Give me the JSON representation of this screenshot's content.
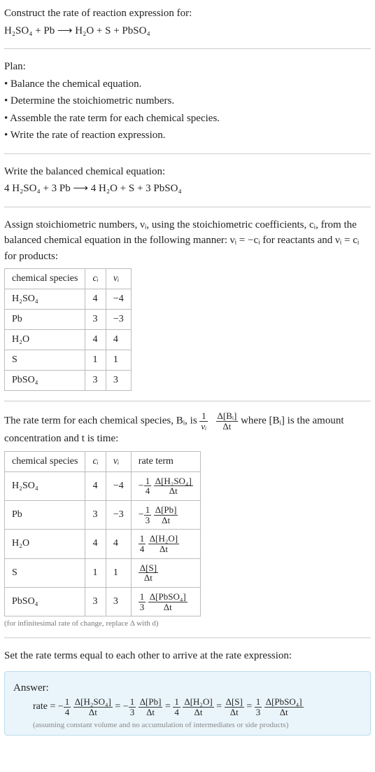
{
  "intro": {
    "title": "Construct the rate of reaction expression for:",
    "equation_unbalanced": "H₂SO₄ + Pb ⟶ H₂O + S + PbSO₄"
  },
  "plan": {
    "heading": "Plan:",
    "items": [
      "• Balance the chemical equation.",
      "• Determine the stoichiometric numbers.",
      "• Assemble the rate term for each chemical species.",
      "• Write the rate of reaction expression."
    ]
  },
  "balanced": {
    "heading": "Write the balanced chemical equation:",
    "equation": "4 H₂SO₄ + 3 Pb ⟶ 4 H₂O + S + 3 PbSO₄"
  },
  "stoich": {
    "heading": "Assign stoichiometric numbers, νᵢ, using the stoichiometric coefficients, cᵢ, from the balanced chemical equation in the following manner: νᵢ = −cᵢ for reactants and νᵢ = cᵢ for products:",
    "headers": [
      "chemical species",
      "cᵢ",
      "νᵢ"
    ],
    "rows": [
      {
        "species": "H₂SO₄",
        "c": "4",
        "nu": "−4"
      },
      {
        "species": "Pb",
        "c": "3",
        "nu": "−3"
      },
      {
        "species": "H₂O",
        "c": "4",
        "nu": "4"
      },
      {
        "species": "S",
        "c": "1",
        "nu": "1"
      },
      {
        "species": "PbSO₄",
        "c": "3",
        "nu": "3"
      }
    ]
  },
  "rateterm": {
    "heading_pre": "The rate term for each chemical species, Bᵢ, is ",
    "heading_post": " where [Bᵢ] is the amount concentration and t is time:",
    "frac_outer_num": "1",
    "frac_outer_den": "νᵢ",
    "frac_inner_num": "Δ[Bᵢ]",
    "frac_inner_den": "Δt",
    "headers": [
      "chemical species",
      "cᵢ",
      "νᵢ",
      "rate term"
    ],
    "rows": [
      {
        "species": "H₂SO₄",
        "c": "4",
        "nu": "−4",
        "sign": "−",
        "coef_num": "1",
        "coef_den": "4",
        "conc_num": "Δ[H₂SO₄]",
        "conc_den": "Δt"
      },
      {
        "species": "Pb",
        "c": "3",
        "nu": "−3",
        "sign": "−",
        "coef_num": "1",
        "coef_den": "3",
        "conc_num": "Δ[Pb]",
        "conc_den": "Δt"
      },
      {
        "species": "H₂O",
        "c": "4",
        "nu": "4",
        "sign": "",
        "coef_num": "1",
        "coef_den": "4",
        "conc_num": "Δ[H₂O]",
        "conc_den": "Δt"
      },
      {
        "species": "S",
        "c": "1",
        "nu": "1",
        "sign": "",
        "coef_num": "",
        "coef_den": "",
        "conc_num": "Δ[S]",
        "conc_den": "Δt"
      },
      {
        "species": "PbSO₄",
        "c": "3",
        "nu": "3",
        "sign": "",
        "coef_num": "1",
        "coef_den": "3",
        "conc_num": "Δ[PbSO₄]",
        "conc_den": "Δt"
      }
    ],
    "caption": "(for infinitesimal rate of change, replace Δ with d)"
  },
  "final": {
    "heading": "Set the rate terms equal to each other to arrive at the rate expression:",
    "answer_label": "Answer:",
    "rate_label": "rate = ",
    "terms": [
      {
        "sign": "−",
        "coef_num": "1",
        "coef_den": "4",
        "conc_num": "Δ[H₂SO₄]",
        "conc_den": "Δt"
      },
      {
        "sign": "−",
        "coef_num": "1",
        "coef_den": "3",
        "conc_num": "Δ[Pb]",
        "conc_den": "Δt"
      },
      {
        "sign": "",
        "coef_num": "1",
        "coef_den": "4",
        "conc_num": "Δ[H₂O]",
        "conc_den": "Δt"
      },
      {
        "sign": "",
        "coef_num": "",
        "coef_den": "",
        "conc_num": "Δ[S]",
        "conc_den": "Δt"
      },
      {
        "sign": "",
        "coef_num": "1",
        "coef_den": "3",
        "conc_num": "Δ[PbSO₄]",
        "conc_den": "Δt"
      }
    ],
    "caption": "(assuming constant volume and no accumulation of intermediates or side products)"
  }
}
